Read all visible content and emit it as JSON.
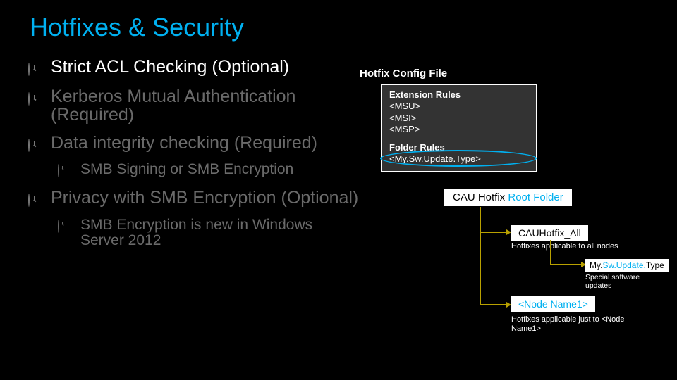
{
  "title": "Hotfixes & Security",
  "bullets": {
    "b1": "Strict ACL Checking (Optional)",
    "b2": "Kerberos Mutual Authentication (Required)",
    "b3": "Data integrity checking (Required)",
    "b3sub": "SMB Signing or SMB Encryption",
    "b4": "Privacy with SMB Encryption (Optional)",
    "b4sub": "SMB Encryption is new in Windows Server 2012"
  },
  "diagram": {
    "config_title": "Hotfix Config File",
    "ext_label": "Extension Rules",
    "ext1": "<MSU>",
    "ext2": "<MSI>",
    "ext3": "<MSP>",
    "folder_label": "Folder Rules",
    "folder_val": "<My.Sw.Update.Type>",
    "root_pre": "CAU Hotfix ",
    "root_accent": "Root Folder",
    "all_box": "CAUHotfix_All",
    "all_desc": "Hotfixes applicable to all nodes",
    "type_pre": "My.",
    "type_mid": "Sw.Update.",
    "type_end": "Type",
    "type_desc": "Special software updates",
    "node_box": "<Node Name1>",
    "node_desc": "Hotfixes applicable just to <Node Name1>"
  }
}
